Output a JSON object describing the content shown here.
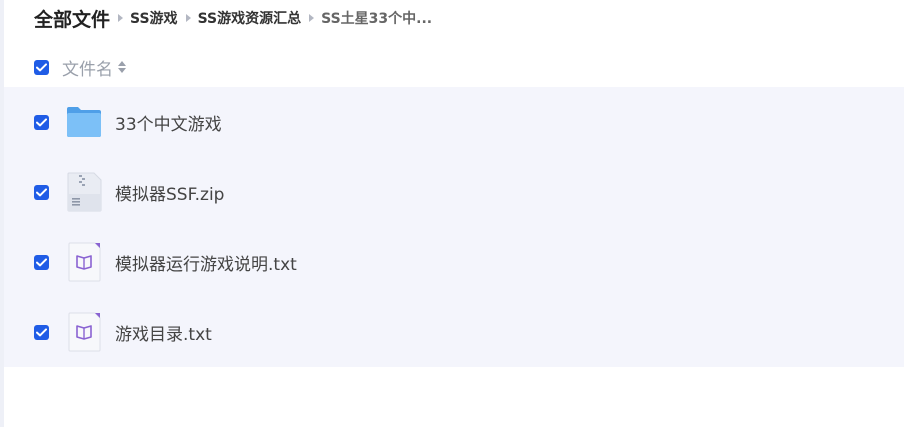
{
  "breadcrumb": {
    "root": "全部文件",
    "items": [
      "SS游戏",
      "SS游戏资源汇总",
      "SS土星33个中..."
    ]
  },
  "list_header": {
    "column_label": "文件名"
  },
  "files": [
    {
      "name": "33个中文游戏",
      "icon": "folder-icon"
    },
    {
      "name": "模拟器SSF.zip",
      "icon": "zip-file-icon"
    },
    {
      "name": "模拟器运行游戏说明.txt",
      "icon": "txt-file-icon"
    },
    {
      "name": "游戏目录.txt",
      "icon": "txt-file-icon"
    }
  ],
  "colors": {
    "checkbox": "#1f5ce6",
    "row_background": "#f4f5fc",
    "folder": "#5aaaf0"
  }
}
